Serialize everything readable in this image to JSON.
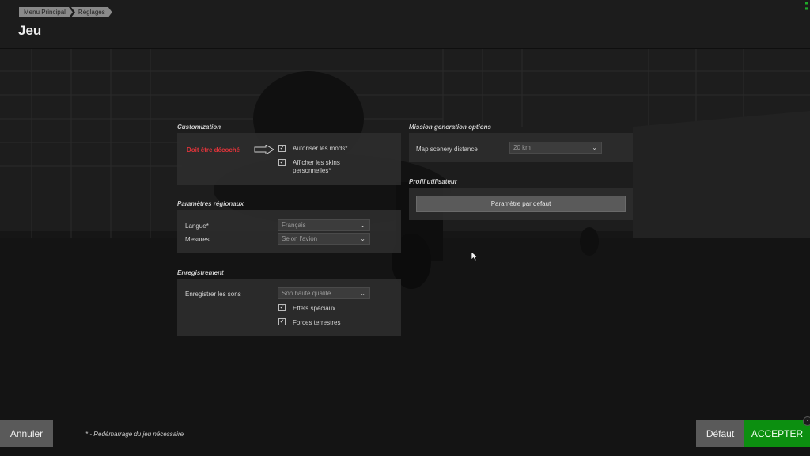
{
  "header": {
    "breadcrumb": [
      "Menu Principal",
      "Réglages"
    ],
    "title": "Jeu"
  },
  "customization": {
    "title": "Customization",
    "warning": "Doit être décoché",
    "mods_label": "Autoriser les mods*",
    "mods_checked": true,
    "skins_label_1": "Afficher les skins",
    "skins_label_2": "personnelles*",
    "skins_checked": true
  },
  "regional": {
    "title": "Paramètres régionaux",
    "language_label": "Langue*",
    "language_value": "Français",
    "units_label": "Mesures",
    "units_value": "Selon l'avion"
  },
  "recording": {
    "title": "Enregistrement",
    "sounds_label": "Enregistrer les sons",
    "sounds_value": "Son haute qualité",
    "effects_label": "Effets spéciaux",
    "effects_checked": true,
    "ground_label": "Forces terrestres",
    "ground_checked": true
  },
  "mission": {
    "title": "Mission generation options",
    "scenery_label": "Map scenery distance",
    "scenery_value": "20 km"
  },
  "profile": {
    "title": "Profil utilisateur",
    "default_button": "Paramètre par defaut"
  },
  "footer": {
    "cancel": "Annuler",
    "note": "* - Redémarrage du jeu nécessaire",
    "defaults": "Défaut",
    "accept": "ACCEPTER"
  },
  "colors": {
    "accent_green": "#0c8f10",
    "warning_red": "#e0343a"
  }
}
